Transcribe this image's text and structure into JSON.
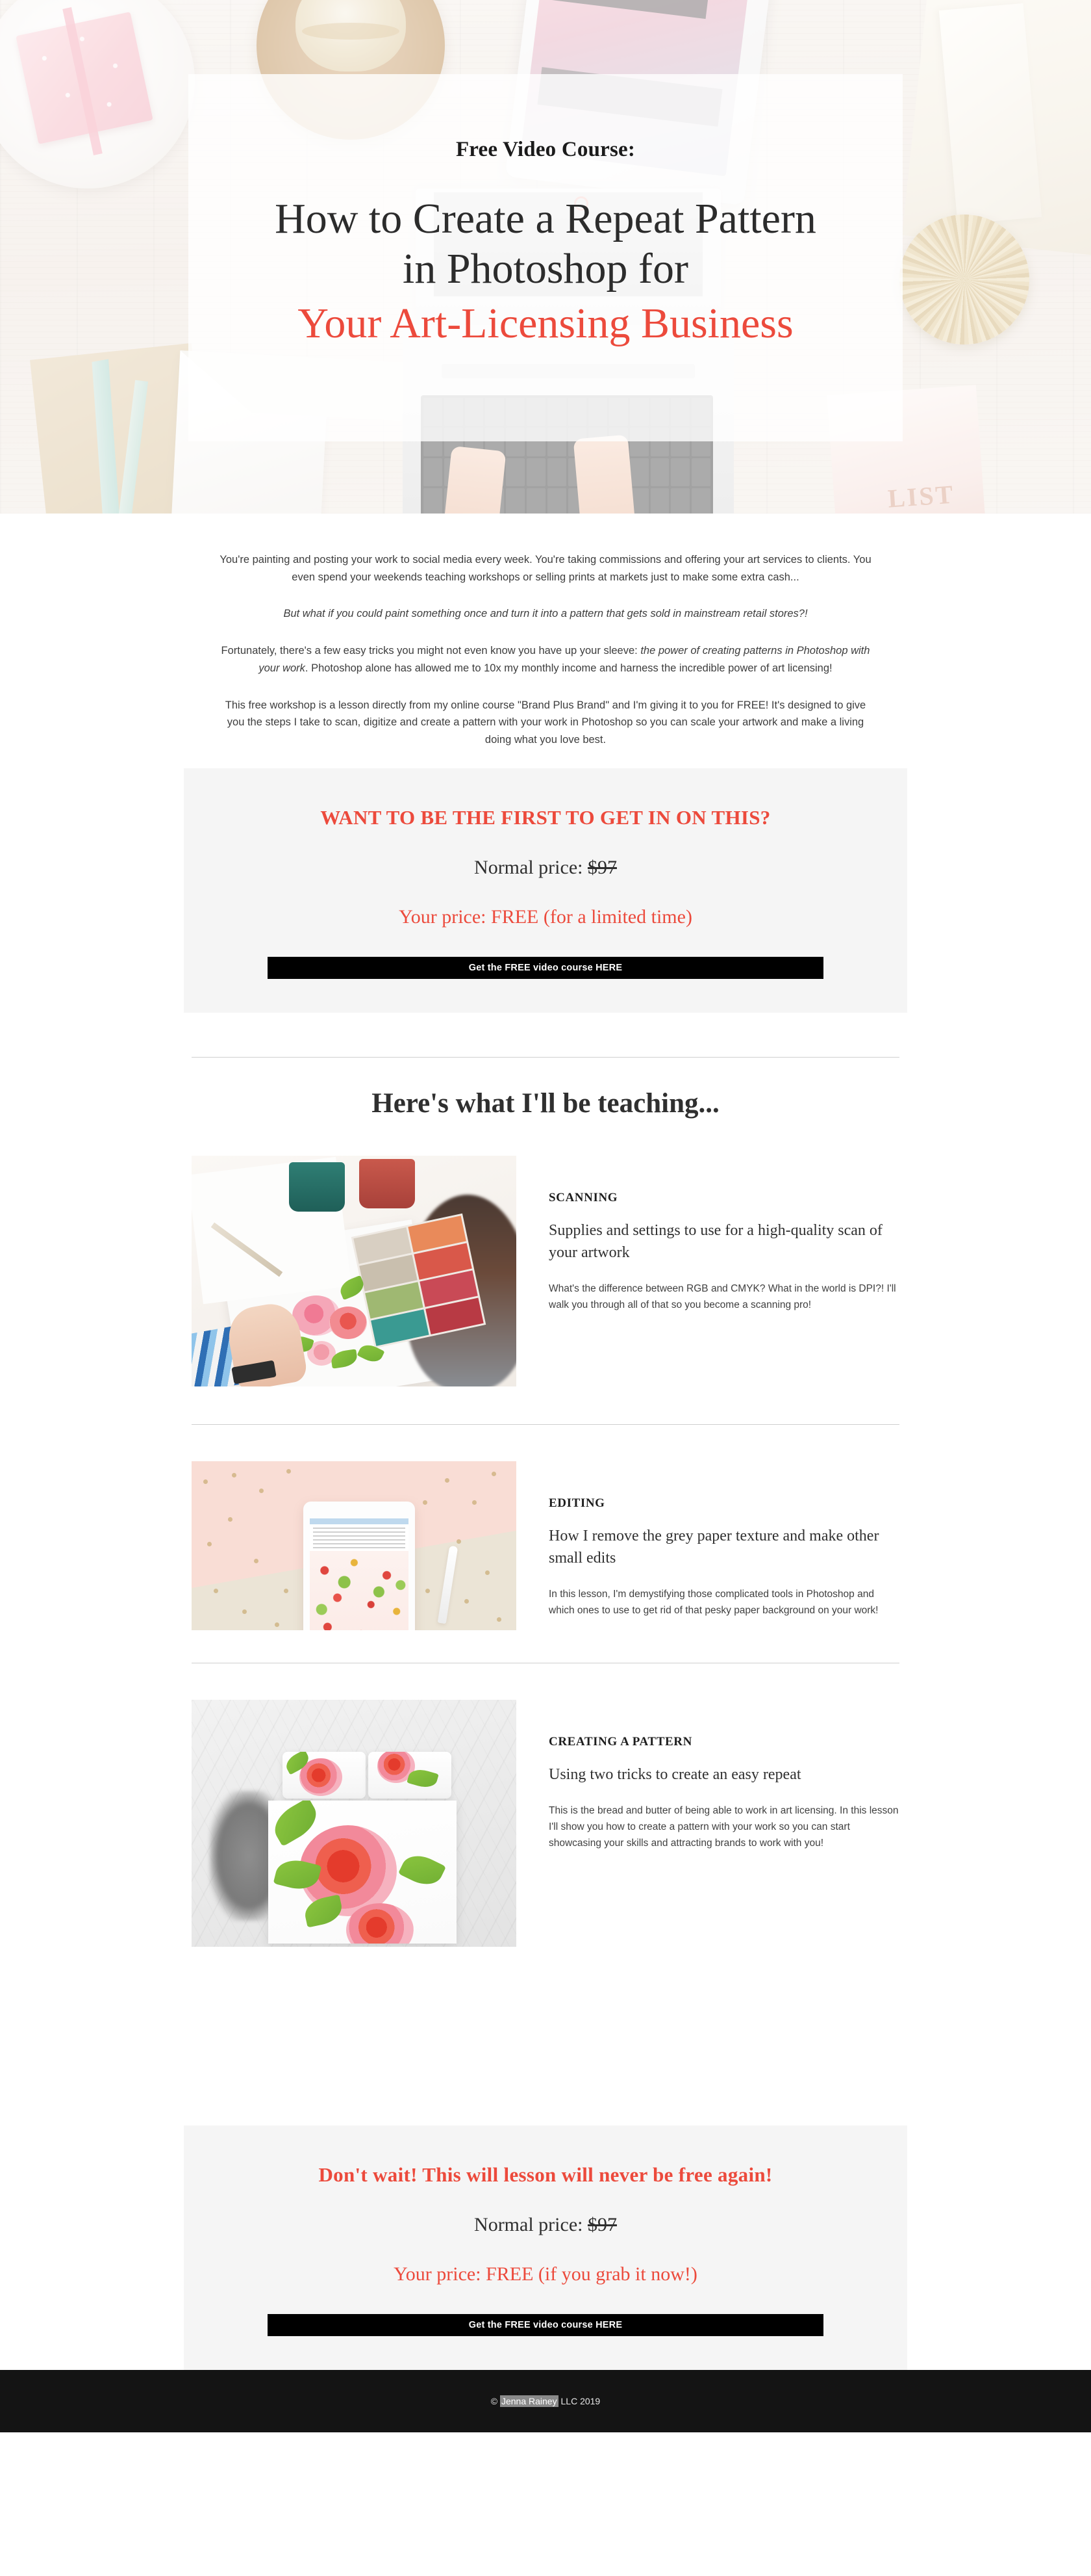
{
  "hero": {
    "eyebrow": "Free Video Course:",
    "title_line1": "How to Create a Repeat Pattern",
    "title_line2": "in Photoshop for",
    "title_accent": "Your Art-Licensing Business",
    "accent_color": "#ec4a3c"
  },
  "intro": {
    "p1": "You're painting and posting your work to social media every week. You're taking commissions and offering your art services to clients. You even spend your weekends teaching workshops or selling prints at markets just to make some extra cash...",
    "p2": "But what if you could paint something once and turn it into a pattern that gets sold in mainstream retail stores?!",
    "p3_a": "Fortunately, there's a few easy tricks you might not even know you have up your sleeve: ",
    "p3_em": "the power of creating patterns in Photoshop with your work",
    "p3_b": ". Photoshop alone has allowed me to 10x my monthly income and harness the incredible power of art licensing!",
    "p4": "This free workshop is a lesson directly from my online course \"Brand Plus Brand\" and I'm giving it to you for FREE! It's designed to give you the steps I take to scan, digitize and create a pattern with your work in Photoshop so you can scale your artwork and make a living doing what you love best."
  },
  "cta_top": {
    "heading": "WANT TO BE THE FIRST TO GET IN ON THIS?",
    "normal_label": "Normal price: ",
    "normal_price": "$97",
    "your_price": "Your price: FREE (for a limited time)",
    "button": "Get the FREE video course HERE"
  },
  "teaching": {
    "title": "Here's what I'll be teaching...",
    "lessons": [
      {
        "kicker": "SCANNING",
        "subtitle": "Supplies and settings to use for a high-quality scan of your artwork",
        "body": "What's the difference between RGB and CMYK? What in the world is DPI?! I'll walk you through all of that so you become a scanning pro!",
        "image_alt": "artist painting watercolor florals with paint pots and palette"
      },
      {
        "kicker": "EDITING",
        "subtitle": "How I remove the grey paper texture and make other small edits",
        "body": "In this lesson, I'm demystifying those complicated tools in Photoshop and which ones to use to get rid of that pesky paper background on your work!",
        "image_alt": "tablet showing floral pattern on pink background with stylus"
      },
      {
        "kicker": "CREATING A PATTERN",
        "subtitle": "Using two tricks to create an easy repeat",
        "body": "This is the bread and butter of being able to work in art licensing. In this lesson I'll show you how to create a pattern with your work so you can start showcasing your skills and attracting brands to work with you!",
        "image_alt": "bed with watercolor rose print bedding on grey floor"
      }
    ]
  },
  "cta_bottom": {
    "heading": "Don't wait! This will lesson will never be free again!",
    "normal_label": "Normal price: ",
    "normal_price": "$97",
    "your_price": "Your price: FREE (if you grab it now!)",
    "button": "Get the FREE video course HERE"
  },
  "footer": {
    "copyright_prefix": "© ",
    "selected_text": "Jenna Rainey",
    "copyright_suffix": " LLC 2019"
  }
}
